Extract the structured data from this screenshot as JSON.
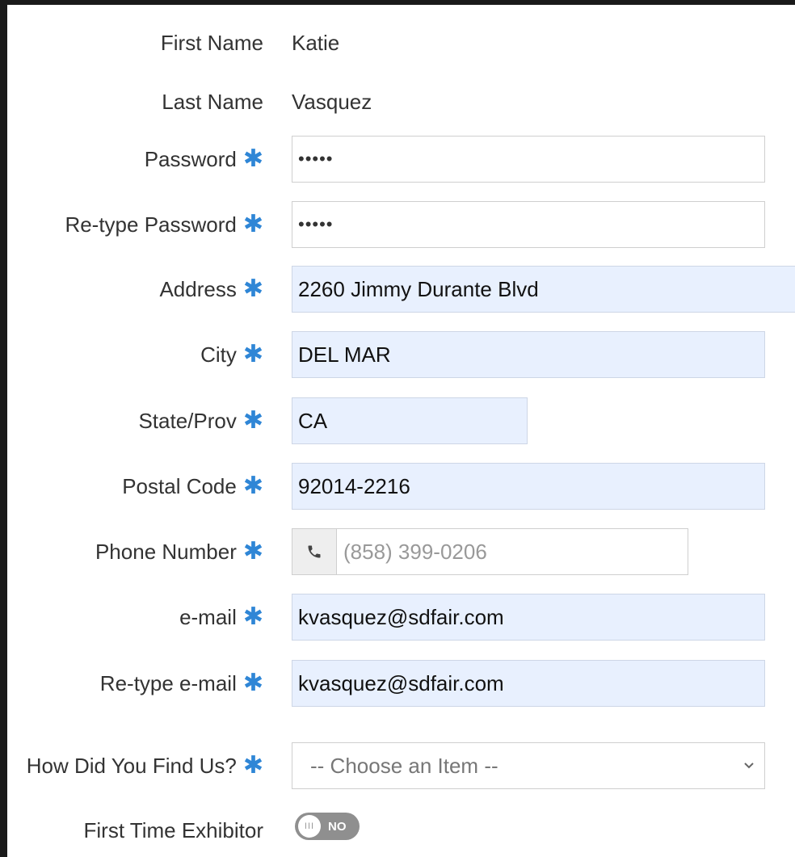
{
  "form": {
    "first_name": {
      "label": "First Name",
      "value": "Katie"
    },
    "last_name": {
      "label": "Last Name",
      "value": "Vasquez"
    },
    "password": {
      "label": "Password",
      "value": "•••••"
    },
    "retype_password": {
      "label": "Re-type Password",
      "value": "•••••"
    },
    "address": {
      "label": "Address",
      "value": "2260 Jimmy Durante Blvd"
    },
    "city": {
      "label": "City",
      "value": "DEL MAR"
    },
    "state": {
      "label": "State/Prov",
      "value": "CA"
    },
    "postal": {
      "label": "Postal Code",
      "value": "92014-2216"
    },
    "phone": {
      "label": "Phone Number",
      "placeholder": "(858) 399-0206",
      "icon": "phone-icon"
    },
    "email": {
      "label": "e-mail",
      "value": "kvasquez@sdfair.com"
    },
    "retype_email": {
      "label": "Re-type e-mail",
      "value": "kvasquez@sdfair.com"
    },
    "find_us": {
      "label": "How Did You Find Us?",
      "selected": "-- Choose an Item --"
    },
    "first_time": {
      "label": "First Time Exhibitor",
      "toggle_text": "NO",
      "checked": false
    },
    "required_mark": "✱",
    "colors": {
      "required": "#2f86d6",
      "autofill": "#e8f0fe"
    }
  }
}
